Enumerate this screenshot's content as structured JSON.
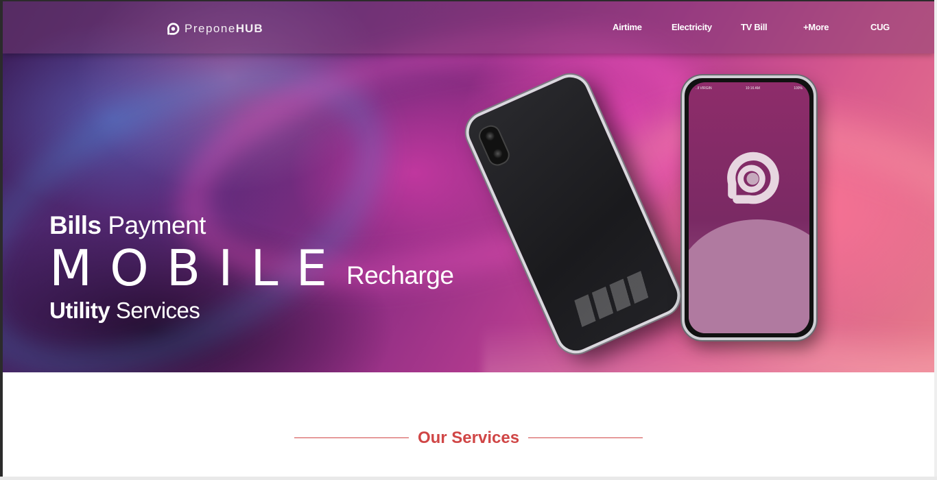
{
  "brand": {
    "name_light": "Prepone",
    "name_bold": "HUB",
    "logo_icon": "preponehub-logo-icon"
  },
  "nav": {
    "items": [
      {
        "label": "Airtime"
      },
      {
        "label": "Electricity"
      },
      {
        "label": "TV Bill"
      },
      {
        "label": "+More"
      },
      {
        "label": "CUG"
      }
    ]
  },
  "hero": {
    "line1_bold": "Bills",
    "line1_light": "Payment",
    "line2_big": "MOBILE",
    "line2_light": "Recharge",
    "line3_bold": "Utility",
    "line3_light": "Services",
    "phone_status_left": "..ll VIRGIN",
    "phone_status_center": "10:16 AM",
    "phone_status_right": "100%"
  },
  "services": {
    "title": "Our Services"
  },
  "colors": {
    "accent": "#d04646",
    "brand_purple": "#8e2c6a",
    "nav_text": "#ffffff"
  }
}
